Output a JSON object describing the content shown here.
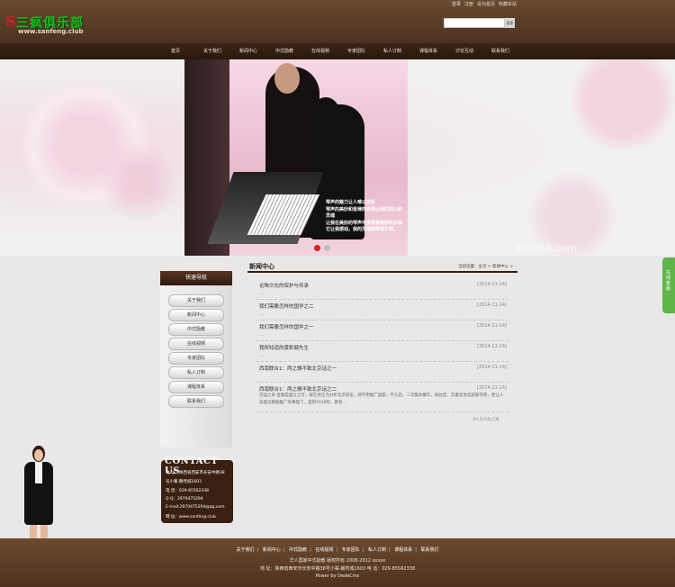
{
  "header": {
    "logo": {
      "mark": "S",
      "name": "三疯俱乐部",
      "url": "www.sanfeng.club"
    },
    "top_links": [
      "登录",
      "注册",
      "设为首页",
      "收藏本站"
    ],
    "search": {
      "placeholder": "",
      "button": "搜索"
    }
  },
  "nav": [
    "首页",
    "关于我们",
    "新闻中心",
    "中式励教",
    "在线视频",
    "专家团队",
    "私人订制",
    "课程体系",
    "讨论互动",
    "联系我们"
  ],
  "banner": {
    "caption_lines": [
      "琴声的魅力让人难以抗拒",
      "琴声的美妙和音律的表现让我们的心和",
      "灵魂",
      "让我在美妙的琴声中享受着美妙的乐曲",
      "它让我感动，我的灵魂被琴音引领。"
    ],
    "watermark": "dede58.com"
  },
  "sidebar": {
    "heading": "快速导航",
    "items": [
      "关于我们",
      "新闻中心",
      "中式励教",
      "在线视频",
      "专家团队",
      "私人订制",
      "课程体系",
      "联系我们"
    ]
  },
  "contact": {
    "title": "CONTACT US",
    "lines": [
      "地 址：陕西省西安市长安中路38",
      "号小寨·朗然城1603",
      "电 话：029-85562338",
      "Q Q：2970475294",
      "E-mail:2970475294@qq.com",
      "网 址：www.sanfeng.club"
    ]
  },
  "news": {
    "title": "新闻中心",
    "breadcrumb": "当前位置：主页 > 新闻中心 >",
    "items": [
      {
        "title": "论陶文化的保护与传承",
        "date": "[2014-11-14]",
        "dash": "..."
      },
      {
        "title": "我们需要怎样的国学之二",
        "date": "[2014-11-14]",
        "dash": "..."
      },
      {
        "title": "我们需要怎样的国学之一",
        "date": "[2014-11-14]",
        "dash": "..."
      },
      {
        "title": "我所知道的黄彰健先生",
        "date": "[2014-11-14]",
        "dash": "..."
      },
      {
        "title": "西南联合1：两之雅不致北京话之一",
        "date": "[2014-11-14]",
        "dash": ""
      },
      {
        "title": "西南联合1：两之雅不致北京话之二",
        "date": "[2014-11-14]",
        "desc": "京国之争 金陵是国立之打，就在并正为分析北京前名，即不用推广国家，不久后，二次集体餐饮，再往后，又曼谈语北就部作积，更让人去理论教据推广的事理了。直到1918年，教育..."
      }
    ],
    "pager": "共1页/6条记录"
  },
  "float_tab": "在线客服",
  "footer": {
    "links": [
      "关于我们",
      "新闻中心",
      "中式励教",
      "在线视频",
      "专家团队",
      "私人订制",
      "课程体系",
      "联系我们"
    ],
    "copyright": "华人国家中式励教 版权所有 2008-2012 xxxxx",
    "address": "地 址：陕西省西安市长安中路38号小寨·朗然城1603 电 话：029-85562338",
    "powered": "Power by DedeCms"
  }
}
